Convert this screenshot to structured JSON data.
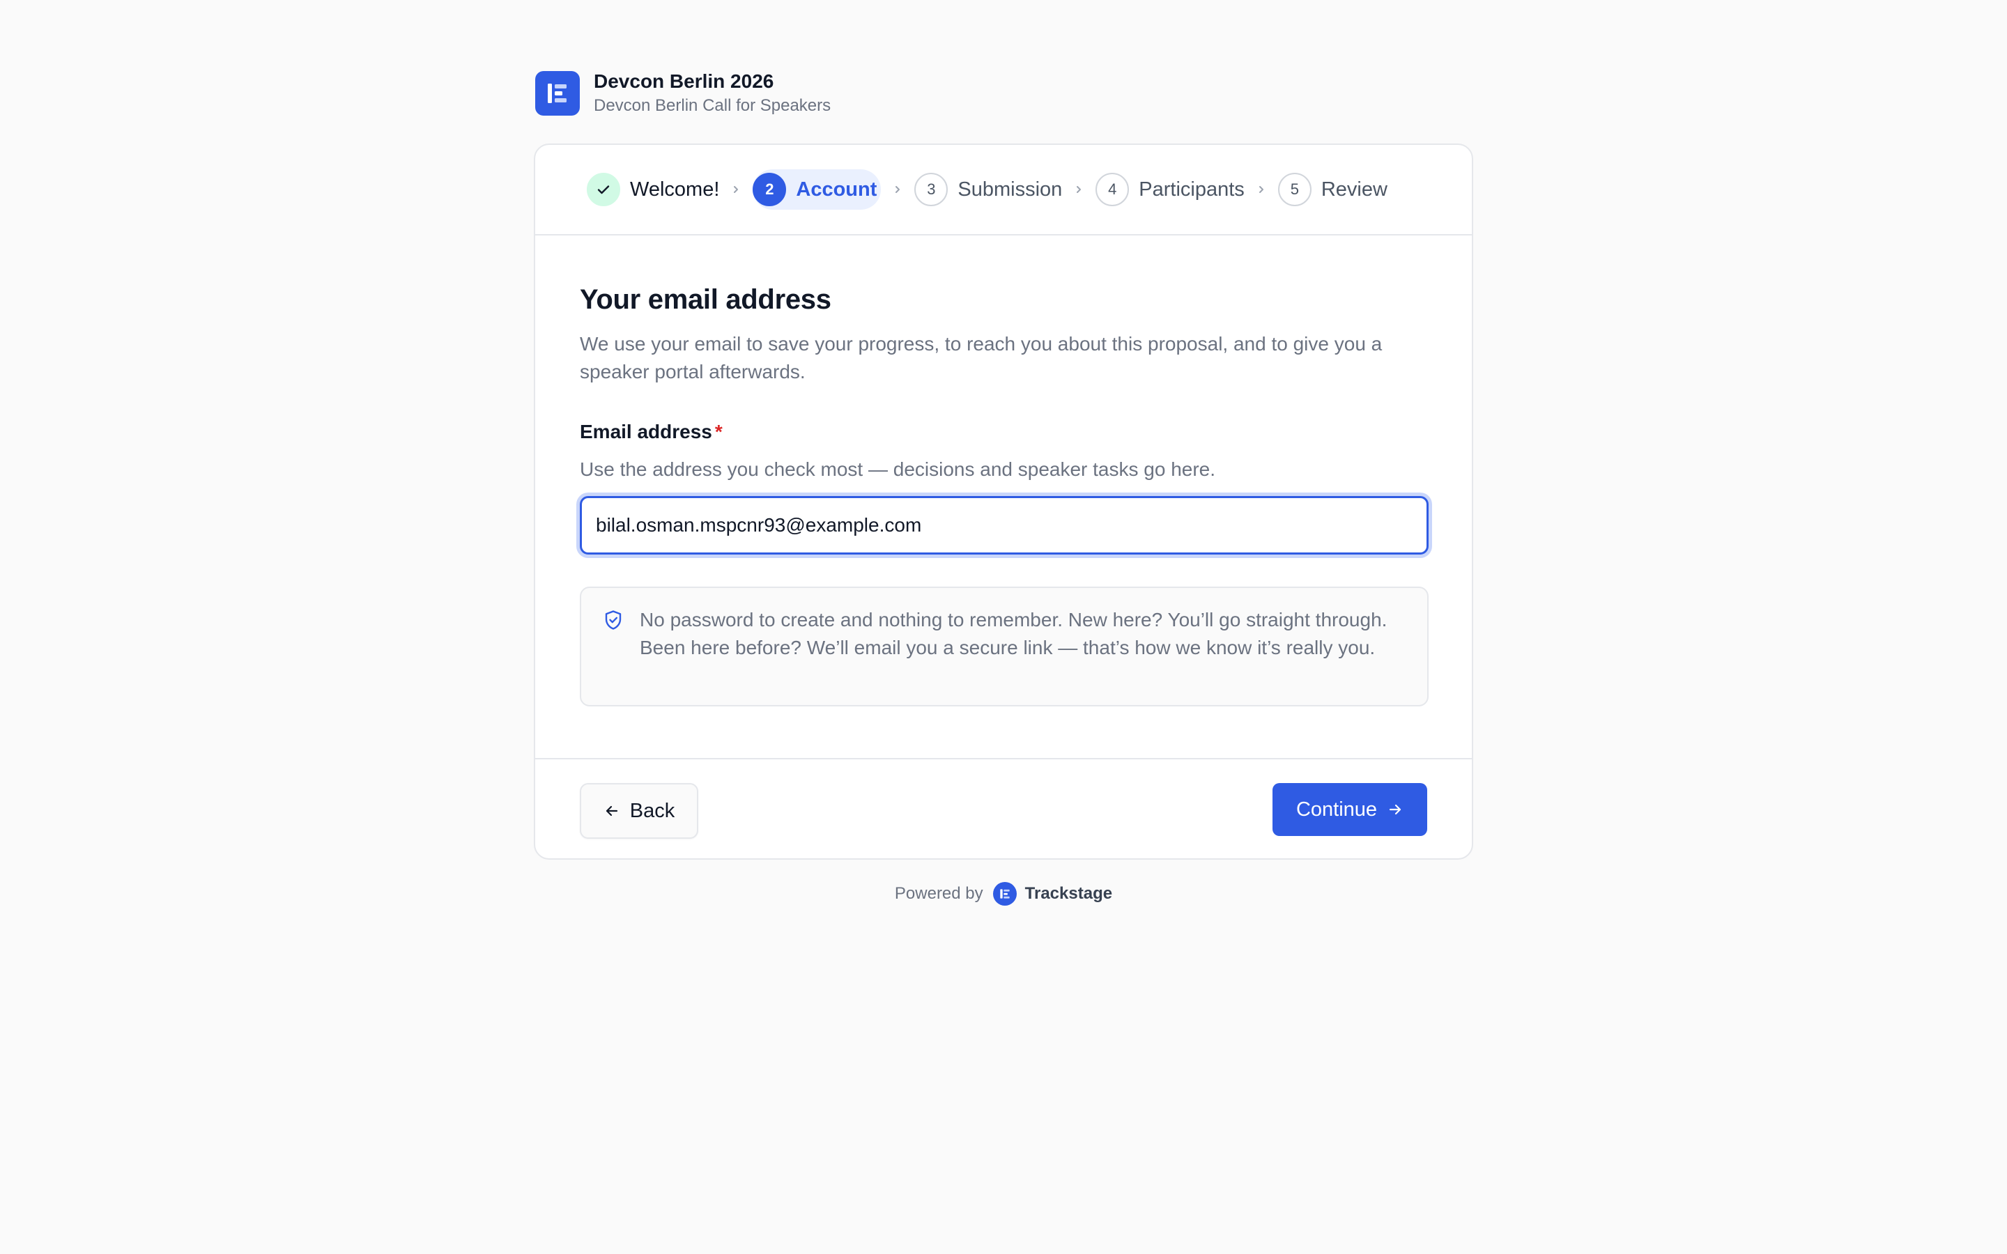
{
  "org": {
    "title": "Devcon Berlin 2026",
    "subtitle": "Devcon Berlin Call for Speakers",
    "logo_icon": "trackstage-logo-icon"
  },
  "stepper": {
    "steps": [
      {
        "number": "",
        "label": "Welcome!",
        "state": "done"
      },
      {
        "number": "2",
        "label": "Account",
        "state": "current"
      },
      {
        "number": "3",
        "label": "Submission",
        "state": "upcoming"
      },
      {
        "number": "4",
        "label": "Participants",
        "state": "upcoming"
      },
      {
        "number": "5",
        "label": "Review",
        "state": "upcoming"
      }
    ]
  },
  "form": {
    "heading": "Your email address",
    "intro": "We use your email to save your progress, to reach you about this proposal, and to give you a speaker portal afterwards.",
    "email_label": "Email address",
    "required_mark": "*",
    "email_hint": "Use the address you check most — decisions and speaker tasks go here.",
    "email_value": "bilal.osman.mspcnr93@example.com",
    "notice": "No password to create and nothing to remember. New here? You’ll go straight through. Been here before? We’ll email you a secure link — that’s how we know it’s really you."
  },
  "actions": {
    "back_label": "Back",
    "continue_label": "Continue"
  },
  "footer": {
    "powered_by": "Powered by",
    "brand": "Trackstage"
  },
  "colors": {
    "accent": "#2f5be3",
    "done_bg": "#d1fae5",
    "required": "#dc2626"
  }
}
